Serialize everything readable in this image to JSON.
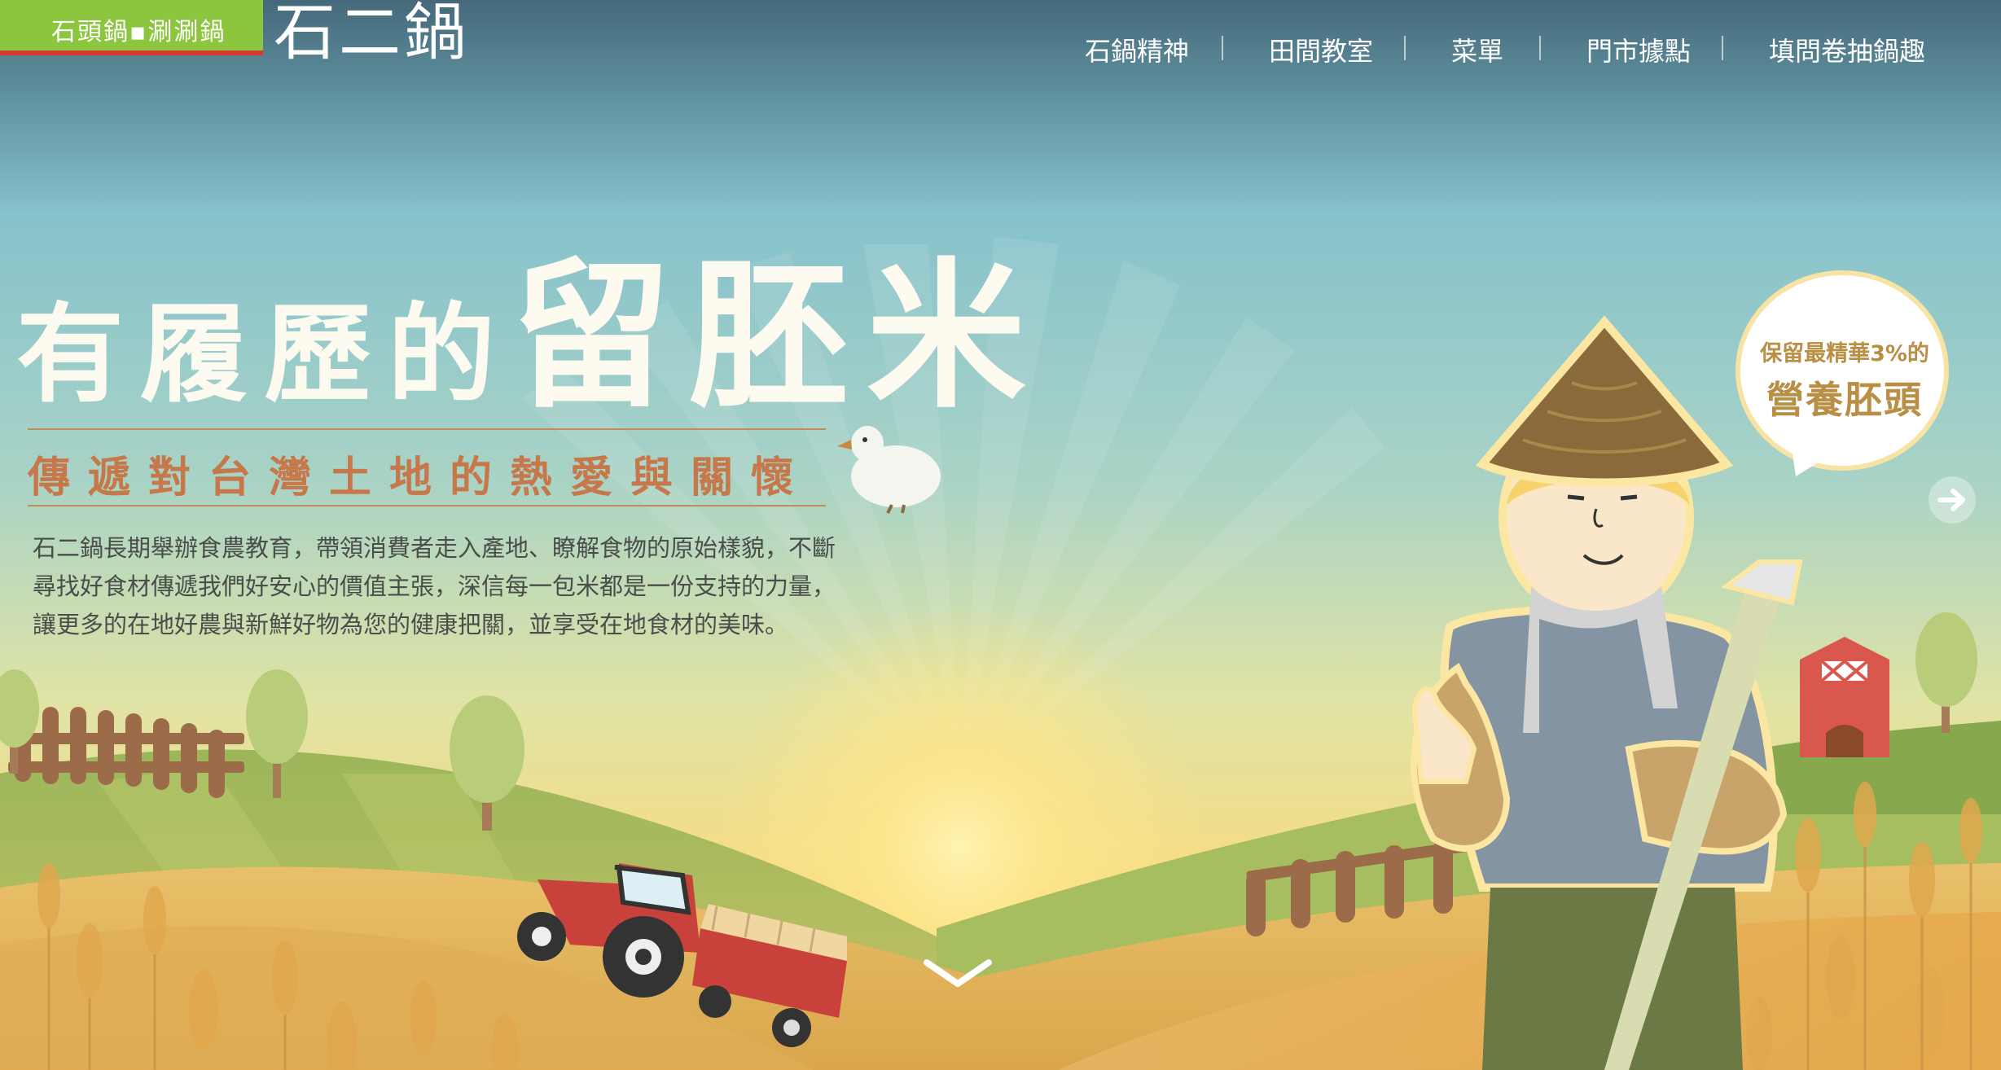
{
  "header": {
    "logo_tag": "石頭鍋▪涮涮鍋",
    "logo_main": "石二鍋",
    "nav": [
      "石鍋精神",
      "田間教室",
      "菜單",
      "門市據點",
      "填問卷抽鍋趣"
    ]
  },
  "hero": {
    "headline_small": "有履歷的",
    "headline_big": "留胚米",
    "subtitle": "傳遞對台灣土地的熱愛與關懷",
    "body": [
      "石二鍋長期舉辦食農教育，帶領消費者走入產地、瞭解食物的原始樣貌，不斷",
      "尋找好食材傳遞我們好安心的價值主張，深信每一包米都是一份支持的力量，",
      "讓更多的在地好農與新鮮好物為您的健康把關，並享受在地食材的美味。"
    ],
    "bubble_line1": "保留最精華3%的",
    "bubble_line2": "營養胚頭"
  },
  "colors": {
    "logo_green": "#8cc63f",
    "logo_red": "#d63a2f",
    "sky_top": "#4f7784",
    "sky_mid": "#8ac5cf",
    "sun": "#fbe38a",
    "subtitle_orange": "#c6784a",
    "bubble_gold": "#b88f44"
  },
  "icons": {
    "next": "arrow-right-circle-icon",
    "scroll": "chevron-down-icon"
  }
}
